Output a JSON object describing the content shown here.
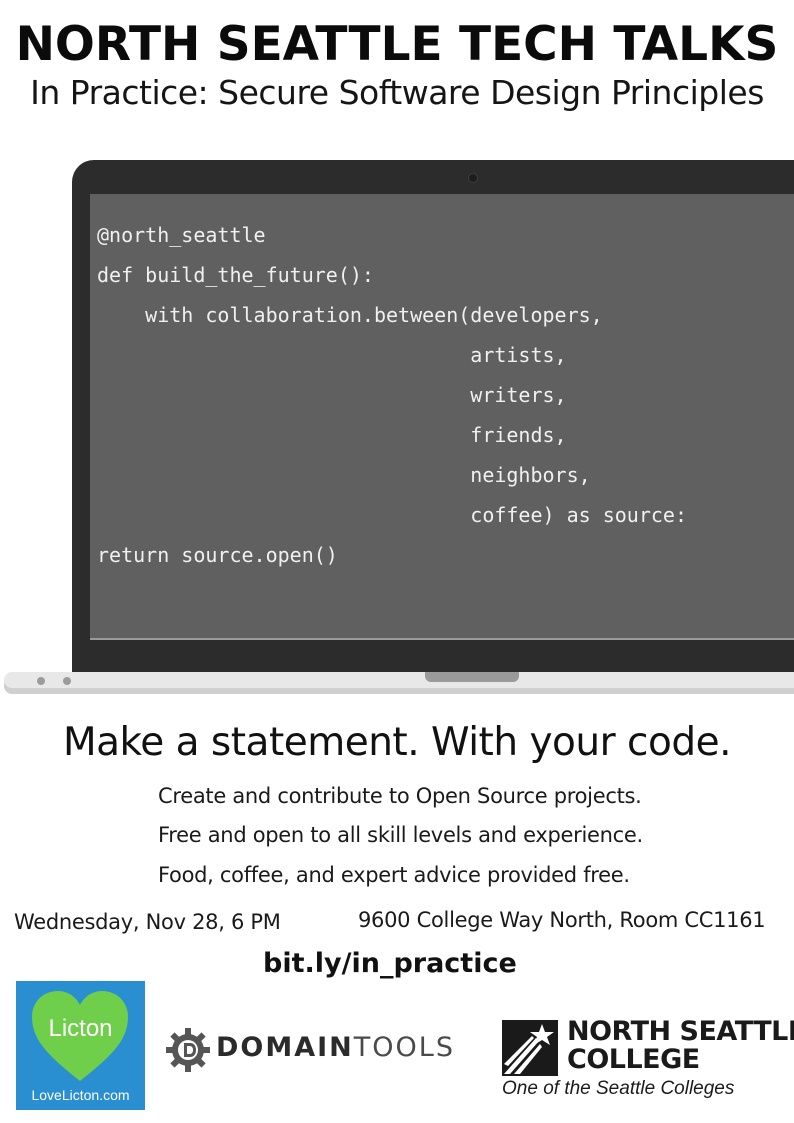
{
  "header": {
    "title": "NORTH SEATTLE TECH TALKS",
    "subtitle": "In Practice: Secure Software Design Principles"
  },
  "code": {
    "lines": [
      "@north_seattle",
      "def build_the_future():",
      "    with collaboration.between(developers,",
      "                               artists,",
      "                               writers,",
      "                               friends,",
      "                               neighbors,",
      "                               coffee) as source:",
      "return source.open()"
    ]
  },
  "tagline": "Make a statement. With your code.",
  "details": [
    "Create and contribute to Open Source projects.",
    "Free and open to all skill levels and experience.",
    "Food, coffee, and expert advice provided free."
  ],
  "event": {
    "date": "Wednesday, Nov 28, 6 PM",
    "address": "9600 College Way North, Room CC1161",
    "link": "bit.ly/in_practice"
  },
  "sponsors": {
    "licton": {
      "name": "Licton",
      "url": "LoveLicton.com",
      "color": "#2a8fd0",
      "heart_color": "#6fcf4a"
    },
    "domaintools": {
      "part1": "DOMAIN",
      "part2": "TOOLS"
    },
    "nsc": {
      "line1": "NORTH SEATTLE",
      "line2": "COLLEGE",
      "tagline": "One of the Seattle Colleges"
    }
  }
}
